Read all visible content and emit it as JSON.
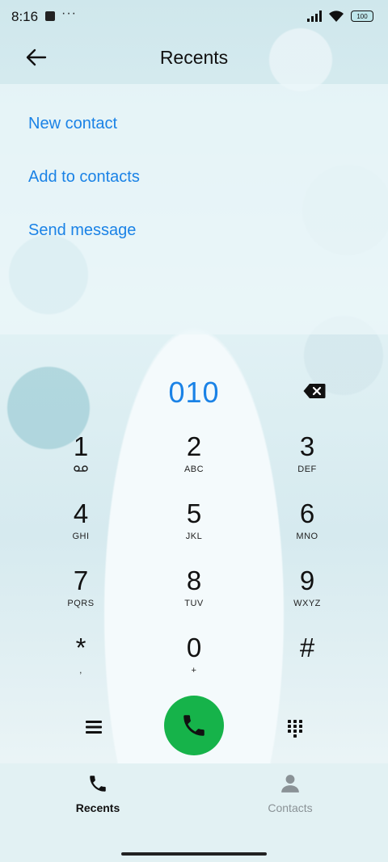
{
  "status_bar": {
    "time": "8:16",
    "dots": "···",
    "battery": "100"
  },
  "header": {
    "title": "Recents"
  },
  "menu": {
    "items": [
      {
        "label": "New contact"
      },
      {
        "label": "Add to contacts"
      },
      {
        "label": "Send message"
      }
    ]
  },
  "dialer": {
    "number": "010",
    "keys": [
      {
        "digit": "1",
        "letters": ""
      },
      {
        "digit": "2",
        "letters": "ABC"
      },
      {
        "digit": "3",
        "letters": "DEF"
      },
      {
        "digit": "4",
        "letters": "GHI"
      },
      {
        "digit": "5",
        "letters": "JKL"
      },
      {
        "digit": "6",
        "letters": "MNO"
      },
      {
        "digit": "7",
        "letters": "PQRS"
      },
      {
        "digit": "8",
        "letters": "TUV"
      },
      {
        "digit": "9",
        "letters": "WXYZ"
      },
      {
        "digit": "*",
        "letters": ","
      },
      {
        "digit": "0",
        "letters": "+"
      },
      {
        "digit": "#",
        "letters": ""
      }
    ]
  },
  "tabs": [
    {
      "label": "Recents",
      "active": true
    },
    {
      "label": "Contacts",
      "active": false
    }
  ],
  "colors": {
    "accent": "#1a82e6",
    "call": "#16b34a",
    "tab_inactive": "#8a9296"
  }
}
